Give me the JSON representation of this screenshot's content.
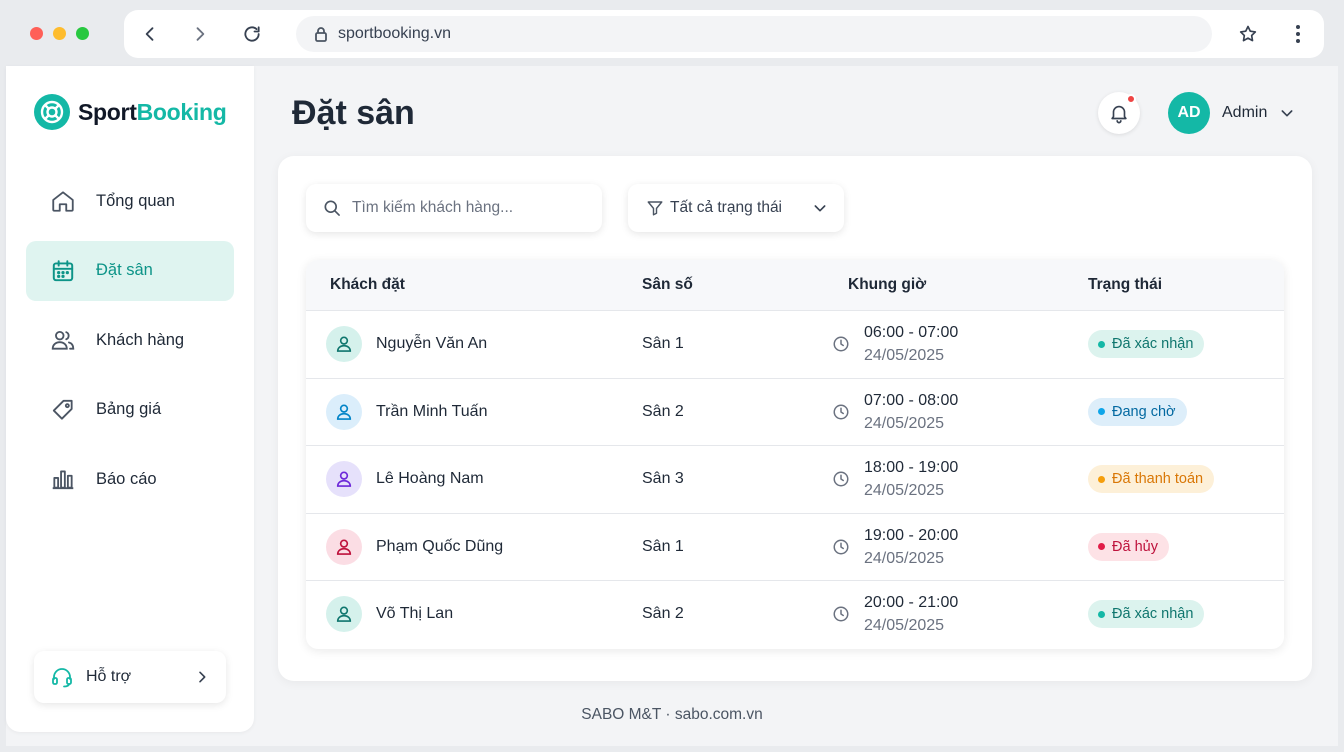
{
  "browser": {
    "url": "sportbooking.vn"
  },
  "brand": {
    "name_part1": "Sport",
    "name_part2": "Booking",
    "accent": "#14b8a6"
  },
  "sidebar": {
    "items": [
      {
        "label": "Tổng quan",
        "icon": "home-icon",
        "active": false
      },
      {
        "label": "Đặt sân",
        "icon": "calendar-icon",
        "active": true
      },
      {
        "label": "Khách hàng",
        "icon": "users-icon",
        "active": false
      },
      {
        "label": "Bảng giá",
        "icon": "tag-icon",
        "active": false
      },
      {
        "label": "Báo cáo",
        "icon": "bar-chart-icon",
        "active": false
      }
    ],
    "support_label": "Hỗ trợ"
  },
  "header": {
    "title": "Đặt sân",
    "user_initials": "AD",
    "user_name": "Admin"
  },
  "filters": {
    "search_placeholder": "Tìm kiếm khách hàng...",
    "status_filter": "Tất cả trạng thái"
  },
  "table": {
    "headers": [
      "Khách đặt",
      "Sân số",
      "Khung giờ",
      "Trạng thái"
    ],
    "rows": [
      {
        "customer": "Nguyễn Văn An",
        "court": "Sân 1",
        "time": "06:00 - 07:00",
        "date": "24/05/2025",
        "status": "Đã xác nhận",
        "status_type": "confirmed",
        "avatar_color": "#0f766e",
        "avatar_bg": "#d5f1ec"
      },
      {
        "customer": "Trần Minh Tuấn",
        "court": "Sân 2",
        "time": "07:00 - 08:00",
        "date": "24/05/2025",
        "status": "Đang chờ",
        "status_type": "pending",
        "avatar_color": "#0284c7",
        "avatar_bg": "#dbeefb"
      },
      {
        "customer": "Lê Hoàng Nam",
        "court": "Sân 3",
        "time": "18:00 - 19:00",
        "date": "24/05/2025",
        "status": "Đã thanh toán",
        "status_type": "paid",
        "avatar_color": "#6d28d9",
        "avatar_bg": "#e6e1fb"
      },
      {
        "customer": "Phạm Quốc Dũng",
        "court": "Sân 1",
        "time": "19:00 - 20:00",
        "date": "24/05/2025",
        "status": "Đã hủy",
        "status_type": "cancelled",
        "avatar_color": "#be123c",
        "avatar_bg": "#fbdde4"
      },
      {
        "customer": "Võ Thị Lan",
        "court": "Sân 2",
        "time": "20:00 - 21:00",
        "date": "24/05/2025",
        "status": "Đã xác nhận",
        "status_type": "confirmed",
        "avatar_color": "#0f766e",
        "avatar_bg": "#d5f1ec"
      }
    ]
  },
  "status_colors": {
    "confirmed": {
      "bg": "#dcf3ee",
      "fg": "#0f766e",
      "dot": "#14b8a6"
    },
    "pending": {
      "bg": "#ddeefa",
      "fg": "#0369a1",
      "dot": "#0ea5e9"
    },
    "paid": {
      "bg": "#fdf0d8",
      "fg": "#d97706",
      "dot": "#f59e0b"
    },
    "cancelled": {
      "bg": "#fde2e6",
      "fg": "#be123c",
      "dot": "#e11d48"
    }
  },
  "footer": {
    "text": "SABO M&T · sabo.com.vn"
  }
}
